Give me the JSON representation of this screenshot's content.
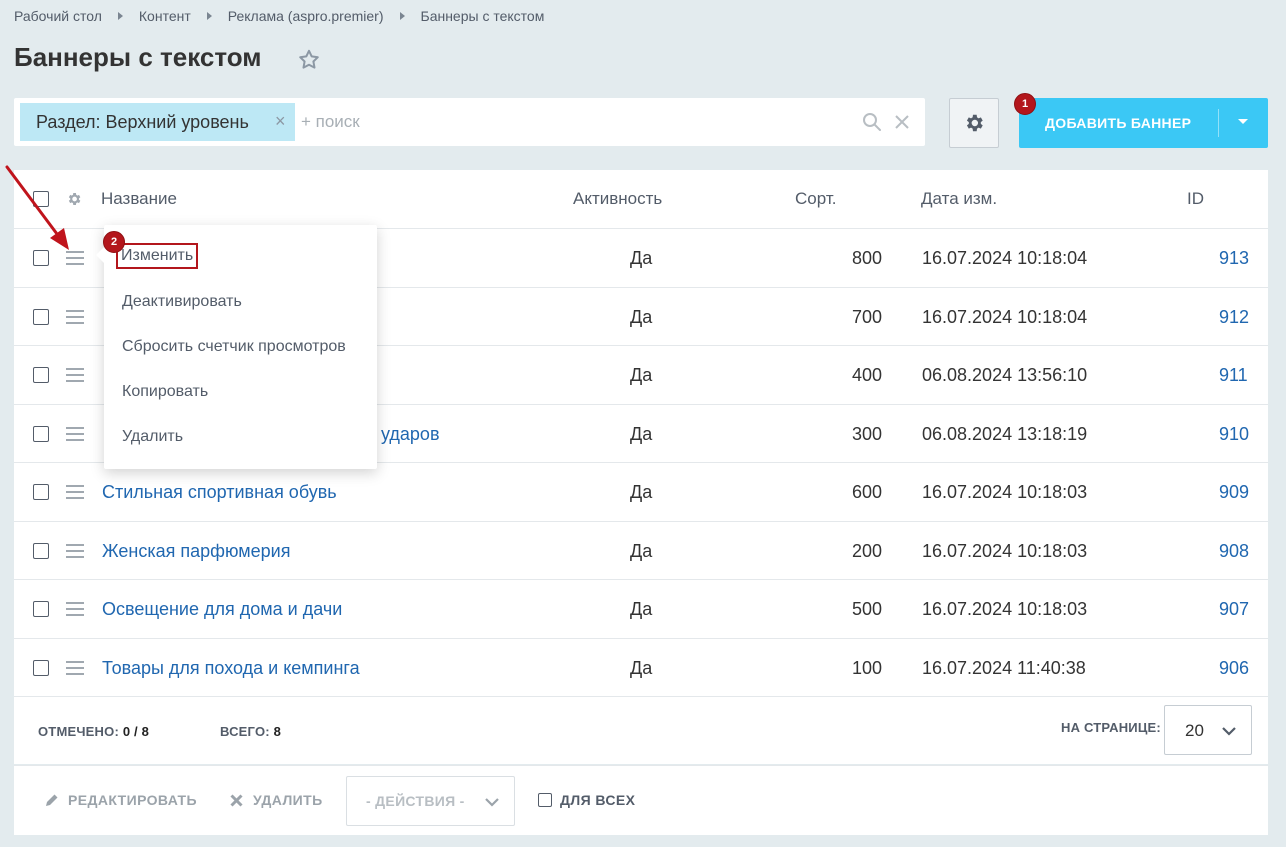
{
  "breadcrumb": [
    "Рабочий стол",
    "Контент",
    "Реклама (aspro.premier)",
    "Баннеры с текстом"
  ],
  "page_title": "Баннеры с текстом",
  "filter": {
    "tag_label": "Раздел: Верхний уровень",
    "tag_close": "×",
    "search_placeholder": "+ поиск"
  },
  "add_button": {
    "label": "ДОБАВИТЬ БАННЕР"
  },
  "badges": {
    "add": "1",
    "edit": "2"
  },
  "grid": {
    "columns": {
      "name": "Название",
      "active": "Активность",
      "sort": "Сорт.",
      "date": "Дата изм.",
      "id": "ID"
    },
    "rows": [
      {
        "name": "",
        "active": "Да",
        "sort": "800",
        "date": "16.07.2024 10:18:04",
        "id": "913"
      },
      {
        "name": "",
        "active": "Да",
        "sort": "700",
        "date": "16.07.2024 10:18:04",
        "id": "912"
      },
      {
        "name": "",
        "active": "Да",
        "sort": "400",
        "date": "06.08.2024 13:56:10",
        "id": "911"
      },
      {
        "name": "ударов",
        "active": "Да",
        "sort": "300",
        "date": "06.08.2024 13:18:19",
        "id": "910"
      },
      {
        "name": "Стильная спортивная обувь",
        "active": "Да",
        "sort": "600",
        "date": "16.07.2024 10:18:03",
        "id": "909"
      },
      {
        "name": "Женская парфюмерия",
        "active": "Да",
        "sort": "200",
        "date": "16.07.2024 10:18:03",
        "id": "908"
      },
      {
        "name": "Освещение для дома и дачи",
        "active": "Да",
        "sort": "500",
        "date": "16.07.2024 10:18:03",
        "id": "907"
      },
      {
        "name": "Товары для похода и кемпинга",
        "active": "Да",
        "sort": "100",
        "date": "16.07.2024 11:40:38",
        "id": "906"
      }
    ]
  },
  "footer": {
    "selected_label": "ОТМЕЧЕНО:",
    "selected_value": "0 / 8",
    "total_label": "ВСЕГО:",
    "total_value": "8",
    "per_page_label": "НА СТРАНИЦЕ:",
    "per_page_value": "20"
  },
  "actions": {
    "edit": "РЕДАКТИРОВАТЬ",
    "delete": "УДАЛИТЬ",
    "select_placeholder": "- ДЕЙСТВИЯ -",
    "for_all": "ДЛЯ ВСЕХ"
  },
  "context_menu": {
    "items": [
      "Изменить",
      "Деактивировать",
      "Сбросить счетчик просмотров",
      "Копировать",
      "Удалить"
    ]
  },
  "colors": {
    "accent": "#3bc8f5",
    "link": "#2067b0",
    "badge": "#b3161c",
    "background": "#e3ebee"
  }
}
